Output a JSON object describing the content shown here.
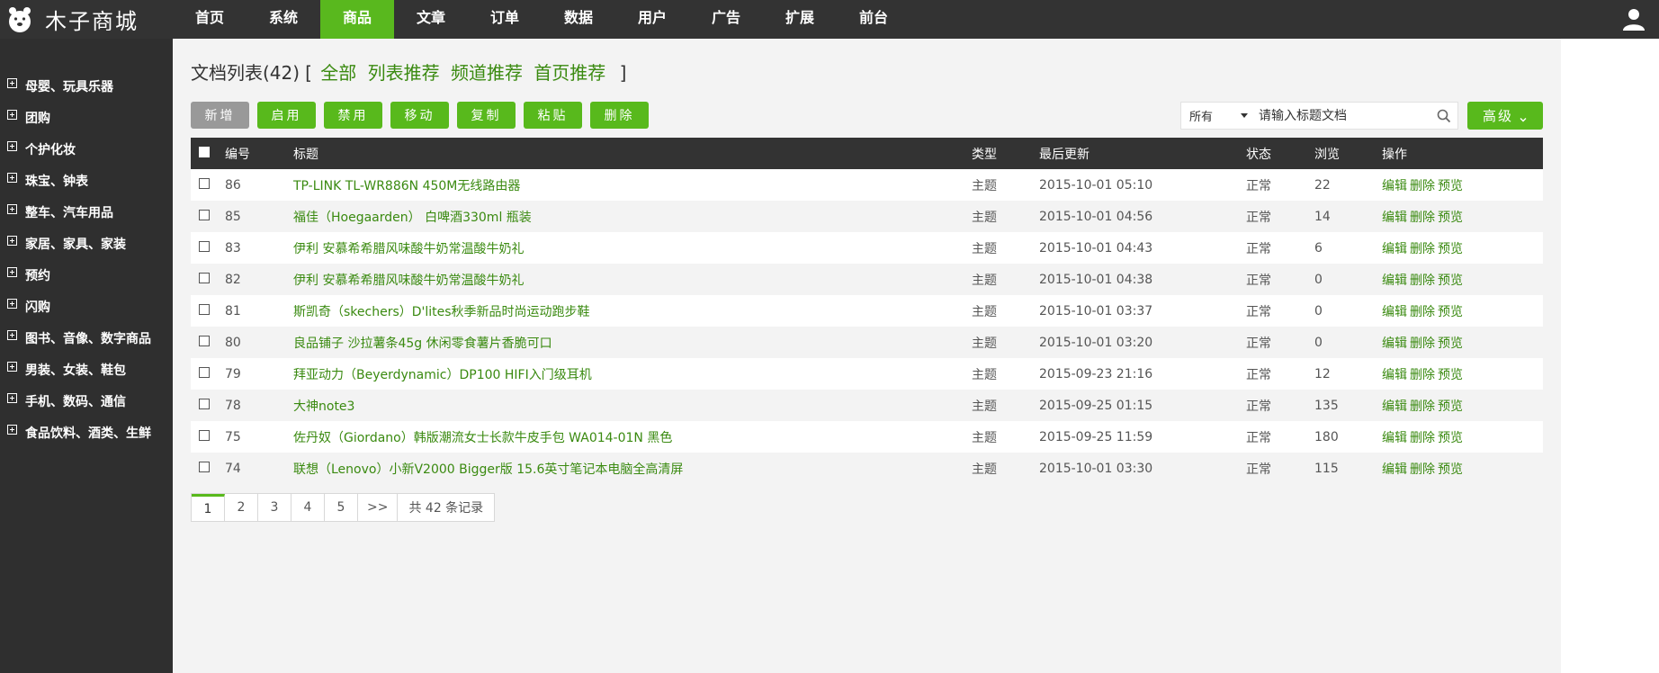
{
  "header": {
    "logo_text": "木子商城",
    "nav": [
      {
        "label": "首页",
        "active": false
      },
      {
        "label": "系统",
        "active": false
      },
      {
        "label": "商品",
        "active": true
      },
      {
        "label": "文章",
        "active": false
      },
      {
        "label": "订单",
        "active": false
      },
      {
        "label": "数据",
        "active": false
      },
      {
        "label": "用户",
        "active": false
      },
      {
        "label": "广告",
        "active": false
      },
      {
        "label": "扩展",
        "active": false
      },
      {
        "label": "前台",
        "active": false
      }
    ]
  },
  "sidebar": {
    "items": [
      "母婴、玩具乐器",
      "团购",
      "个护化妆",
      "珠宝、钟表",
      "整车、汽车用品",
      "家居、家具、家装",
      "预约",
      "闪购",
      "图书、音像、数字商品",
      "男装、女装、鞋包",
      "手机、数码、通信",
      "食品饮料、酒类、生鲜"
    ]
  },
  "main": {
    "title": "文档列表(42)",
    "filter_open": "[",
    "filter_close": "]",
    "filters": [
      "全部",
      "列表推荐",
      "频道推荐",
      "首页推荐"
    ],
    "toolbar": {
      "add": "新增",
      "enable": "启用",
      "disable": "禁用",
      "move": "移动",
      "copy": "复制",
      "paste": "粘贴",
      "delete": "删除"
    },
    "search": {
      "select_value": "所有",
      "placeholder": "请输入标题文档",
      "advanced": "高级"
    },
    "table": {
      "headers": [
        "编号",
        "标题",
        "类型",
        "最后更新",
        "状态",
        "浏览",
        "操作"
      ],
      "rows": [
        {
          "id": "86",
          "title": "TP-LINK TL-WR886N 450M无线路由器",
          "type": "主题",
          "updated": "2015-10-01 05:10",
          "status": "正常",
          "views": "22"
        },
        {
          "id": "85",
          "title": "福佳（Hoegaarden） 白啤酒330ml 瓶装",
          "type": "主题",
          "updated": "2015-10-01 04:56",
          "status": "正常",
          "views": "14"
        },
        {
          "id": "83",
          "title": "伊利 安慕希希腊风味酸牛奶常温酸牛奶礼",
          "type": "主题",
          "updated": "2015-10-01 04:43",
          "status": "正常",
          "views": "6"
        },
        {
          "id": "82",
          "title": "伊利 安慕希希腊风味酸牛奶常温酸牛奶礼",
          "type": "主题",
          "updated": "2015-10-01 04:38",
          "status": "正常",
          "views": "0"
        },
        {
          "id": "81",
          "title": "斯凯奇（skechers）D'lites秋季新品时尚运动跑步鞋",
          "type": "主题",
          "updated": "2015-10-01 03:37",
          "status": "正常",
          "views": "0"
        },
        {
          "id": "80",
          "title": "良品铺子 沙拉薯条45g 休闲零食薯片香脆可口",
          "type": "主题",
          "updated": "2015-10-01 03:20",
          "status": "正常",
          "views": "0"
        },
        {
          "id": "79",
          "title": "拜亚动力（Beyerdynamic）DP100 HIFI入门级耳机",
          "type": "主题",
          "updated": "2015-09-23 21:16",
          "status": "正常",
          "views": "12"
        },
        {
          "id": "78",
          "title": "大神note3",
          "type": "主题",
          "updated": "2015-09-25 01:15",
          "status": "正常",
          "views": "135"
        },
        {
          "id": "75",
          "title": "佐丹奴（Giordano）韩版潮流女士长款牛皮手包 WA014-01N 黑色",
          "type": "主题",
          "updated": "2015-09-25 11:59",
          "status": "正常",
          "views": "180"
        },
        {
          "id": "74",
          "title": "联想（Lenovo）小新V2000 Bigger版 15.6英寸笔记本电脑全高清屏",
          "type": "主题",
          "updated": "2015-10-01 03:30",
          "status": "正常",
          "views": "115"
        }
      ],
      "ops": [
        "编辑",
        "删除",
        "预览"
      ]
    },
    "pagination": {
      "pages": [
        "1",
        "2",
        "3",
        "4",
        "5"
      ],
      "active": "1",
      "next": ">>",
      "total": "共 42 条记录"
    }
  }
}
